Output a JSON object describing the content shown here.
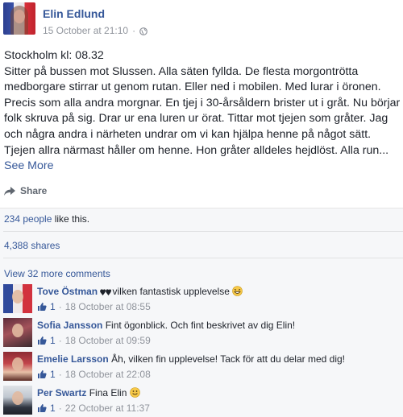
{
  "post": {
    "author": "Elin Edlund",
    "timestamp": "15 October at 21:10",
    "separator": "·",
    "privacy_icon": "globe-icon",
    "headline": "Stockholm kl: 08.32",
    "body": "Sitter på bussen mot Slussen. Alla säten fyllda. De flesta morgontrötta medborgare stirrar ut genom rutan. Eller ned i mobilen. Med lurar i öronen. Precis som alla andra morgnar. En tjej i 30-årsåldern brister ut i gråt. Nu börjar folk skruva på sig. Drar ur ena luren ur örat. Tittar mot tjejen som gråter. Jag och några andra i närheten undrar om vi kan hjälpa henne på något sätt. Tjejen allra närmast håller om henne. Hon gråter alldeles hejdlöst. Alla run...",
    "see_more": "See More",
    "share_label": "Share"
  },
  "stats": {
    "likes_link": "234 people",
    "likes_suffix": " like this.",
    "shares": "4,388 shares",
    "view_more_comments": "View 32 more comments"
  },
  "comments": [
    {
      "name": "Tove Östman",
      "text": "vilken fantastisk upplevelse ",
      "likes": "1",
      "time": "18 October at 08:55",
      "emoji_before": "two-hearts-icon",
      "emoji_after": "grinning-face-icon"
    },
    {
      "name": "Sofia Jansson",
      "text": "Fint ögonblick. Och fint beskrivet av dig Elin!",
      "likes": "1",
      "time": "18 October at 09:59"
    },
    {
      "name": "Emelie Larsson",
      "text": "Åh, vilken fin upplevelse! Tack för att du delar med dig!",
      "likes": "1",
      "time": "18 October at 22:08"
    },
    {
      "name": "Per Swartz",
      "text": "Fina Elin ",
      "likes": "1",
      "time": "22 October at 11:37",
      "emoji_after": "smiley-icon"
    }
  ],
  "meta_dot": "·",
  "colors": {
    "link": "#365899",
    "meta": "#90949c",
    "text": "#1d2129",
    "panel": "#f6f7f9"
  }
}
